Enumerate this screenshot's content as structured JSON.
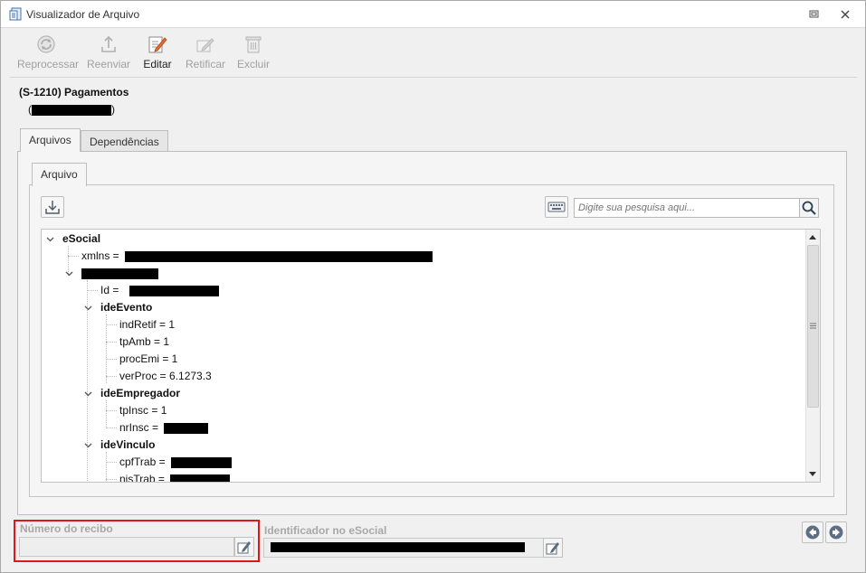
{
  "window": {
    "title": "Visualizador de Arquivo"
  },
  "toolbar": {
    "reprocessar": "Reprocessar",
    "reenviar": "Reenviar",
    "editar": "Editar",
    "retificar": "Retificar",
    "excluir": "Excluir"
  },
  "event": {
    "title": "(S-1210) Pagamentos",
    "open_paren": "(",
    "close_paren": ")"
  },
  "tabs": {
    "arquivos": "Arquivos",
    "dependencias": "Dependências",
    "arquivo": "Arquivo"
  },
  "search": {
    "placeholder": "Digite sua pesquisa aqui..."
  },
  "tree": {
    "esocial": "eSocial",
    "xmlns": "xmlns =",
    "id": "Id =",
    "ide_evento": "ideEvento",
    "ind_retif": "indRetif = 1",
    "tp_amb": "tpAmb = 1",
    "proc_emi": "procEmi = 1",
    "ver_proc": "verProc = 6.1273.3",
    "ide_empregador": "ideEmpregador",
    "tp_insc": "tpInsc = 1",
    "nr_insc": "nrInsc =",
    "ide_vinculo": "ideVinculo",
    "cpf_trab": "cpfTrab =",
    "nis_trab": "nisTrab ="
  },
  "fields": {
    "numero_recibo_label": "Número do recibo",
    "identificador_label": "Identificador no eSocial"
  },
  "icons": {
    "app": "file-viewer-icon",
    "restore": "restore-icon",
    "close": "close-icon",
    "reprocess": "reprocess-icon",
    "resend": "upload-icon",
    "edit": "edit-icon",
    "rectify": "rectify-icon",
    "delete": "trash-icon",
    "download": "download-icon",
    "keyboard": "keyboard-icon",
    "search": "search-icon",
    "prev": "arrow-left-icon",
    "next": "arrow-right-icon"
  },
  "colors": {
    "highlight": "#e0161b",
    "disabled_text": "#a0a0a0",
    "field_label": "#a8a8a8"
  }
}
